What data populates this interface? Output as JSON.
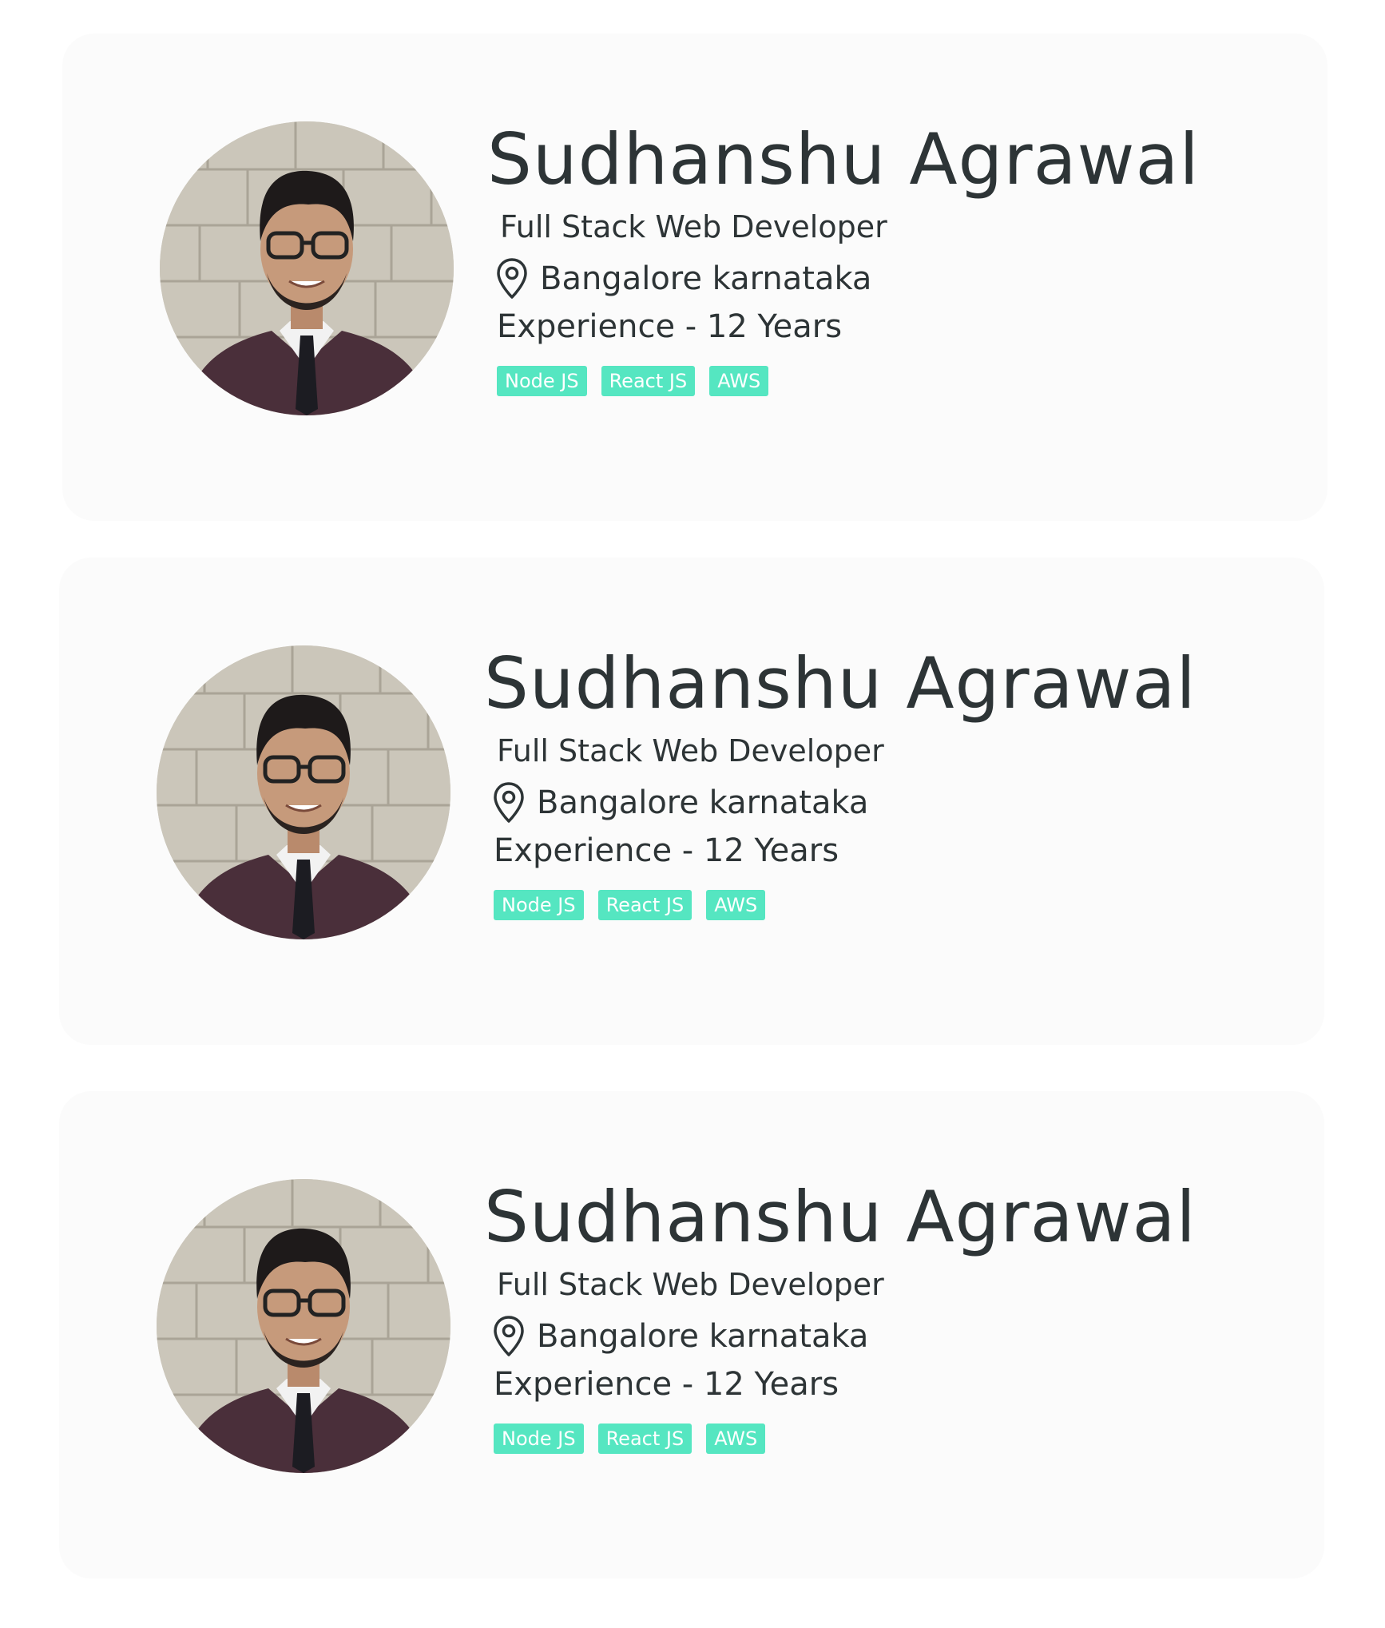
{
  "profiles": [
    {
      "name": "Sudhanshu Agrawal",
      "role": "Full Stack Web Developer",
      "location": "Bangalore karnataka",
      "location_icon": "map-pin-icon",
      "experience": "Experience - 12 Years",
      "tags": [
        "Node JS",
        "React JS",
        "AWS"
      ]
    },
    {
      "name": "Sudhanshu Agrawal",
      "role": "Full Stack Web Developer",
      "location": "Bangalore karnataka",
      "location_icon": "map-pin-icon",
      "experience": "Experience - 12 Years",
      "tags": [
        "Node JS",
        "React JS",
        "AWS"
      ]
    },
    {
      "name": "Sudhanshu Agrawal",
      "role": "Full Stack Web Developer",
      "location": "Bangalore karnataka",
      "location_icon": "map-pin-icon",
      "experience": "Experience - 12 Years",
      "tags": [
        "Node JS",
        "React JS",
        "AWS"
      ]
    }
  ],
  "colors": {
    "card_background": "#fbfbfb",
    "text": "#2d3436",
    "tag_background": "#55e6c1",
    "tag_text": "#ffffff"
  }
}
